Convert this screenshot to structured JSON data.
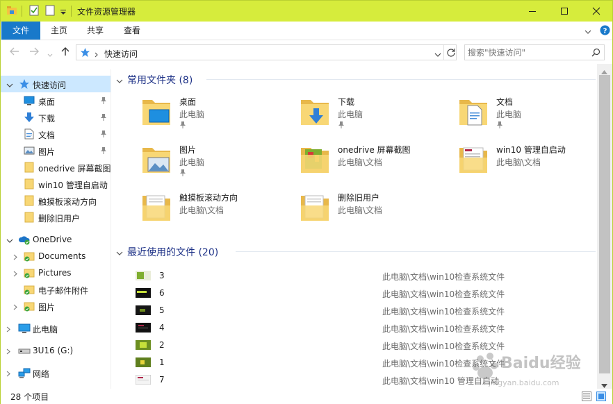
{
  "window": {
    "title": "文件资源管理器"
  },
  "ribbon": {
    "tabs": [
      "文件",
      "主页",
      "共享",
      "查看"
    ]
  },
  "address": {
    "location": "快速访问",
    "search_placeholder": "搜索\"快速访问\""
  },
  "nav": {
    "quick_access": "快速访问",
    "quick_items": [
      {
        "label": "桌面",
        "icon": "desktop-icon",
        "pinned": true
      },
      {
        "label": "下载",
        "icon": "download-icon",
        "pinned": true
      },
      {
        "label": "文档",
        "icon": "document-icon",
        "pinned": true
      },
      {
        "label": "图片",
        "icon": "picture-icon",
        "pinned": true
      },
      {
        "label": "onedrive 屏幕截图",
        "icon": "folder-icon",
        "pinned": false
      },
      {
        "label": "win10 管理自启动",
        "icon": "folder-icon",
        "pinned": false
      },
      {
        "label": "触摸板滚动方向",
        "icon": "folder-icon",
        "pinned": false
      },
      {
        "label": "删除旧用户",
        "icon": "folder-icon",
        "pinned": false
      }
    ],
    "onedrive": "OneDrive",
    "onedrive_items": [
      "Documents",
      "Pictures",
      "电子邮件附件",
      "图片"
    ],
    "this_pc": "此电脑",
    "drive": "3U16 (G:)",
    "network": "网络"
  },
  "frequent": {
    "header": "常用文件夹 (8)",
    "items": [
      {
        "name": "桌面",
        "location": "此电脑",
        "pinned": true
      },
      {
        "name": "下载",
        "location": "此电脑",
        "pinned": true
      },
      {
        "name": "文档",
        "location": "此电脑",
        "pinned": true
      },
      {
        "name": "图片",
        "location": "此电脑",
        "pinned": true
      },
      {
        "name": "onedrive 屏幕截图",
        "location": "此电脑\\文档",
        "pinned": false
      },
      {
        "name": "win10 管理自启动",
        "location": "此电脑\\文档",
        "pinned": false
      },
      {
        "name": "触摸板滚动方向",
        "location": "此电脑\\文档",
        "pinned": false
      },
      {
        "name": "删除旧用户",
        "location": "此电脑\\文档",
        "pinned": false
      }
    ]
  },
  "recent": {
    "header": "最近使用的文件 (20)",
    "items": [
      {
        "name": "3",
        "path": "此电脑\\文档\\win10检查系统文件"
      },
      {
        "name": "6",
        "path": "此电脑\\文档\\win10检查系统文件"
      },
      {
        "name": "5",
        "path": "此电脑\\文档\\win10检查系统文件"
      },
      {
        "name": "4",
        "path": "此电脑\\文档\\win10检查系统文件"
      },
      {
        "name": "2",
        "path": "此电脑\\文档\\win10检查系统文件"
      },
      {
        "name": "1",
        "path": "此电脑\\文档\\win10检查系统文件"
      },
      {
        "name": "7",
        "path": "此电脑\\文档\\win10 管理自启动"
      }
    ]
  },
  "status": {
    "count": "28 个项目"
  },
  "watermark": {
    "text": "Baidu经验",
    "url": "jingyan.baidu.com"
  },
  "colors": {
    "accent": "#1979ca",
    "titlebar": "#d6ec3c",
    "selection": "#cce8ff",
    "group_header": "#1e3287"
  }
}
